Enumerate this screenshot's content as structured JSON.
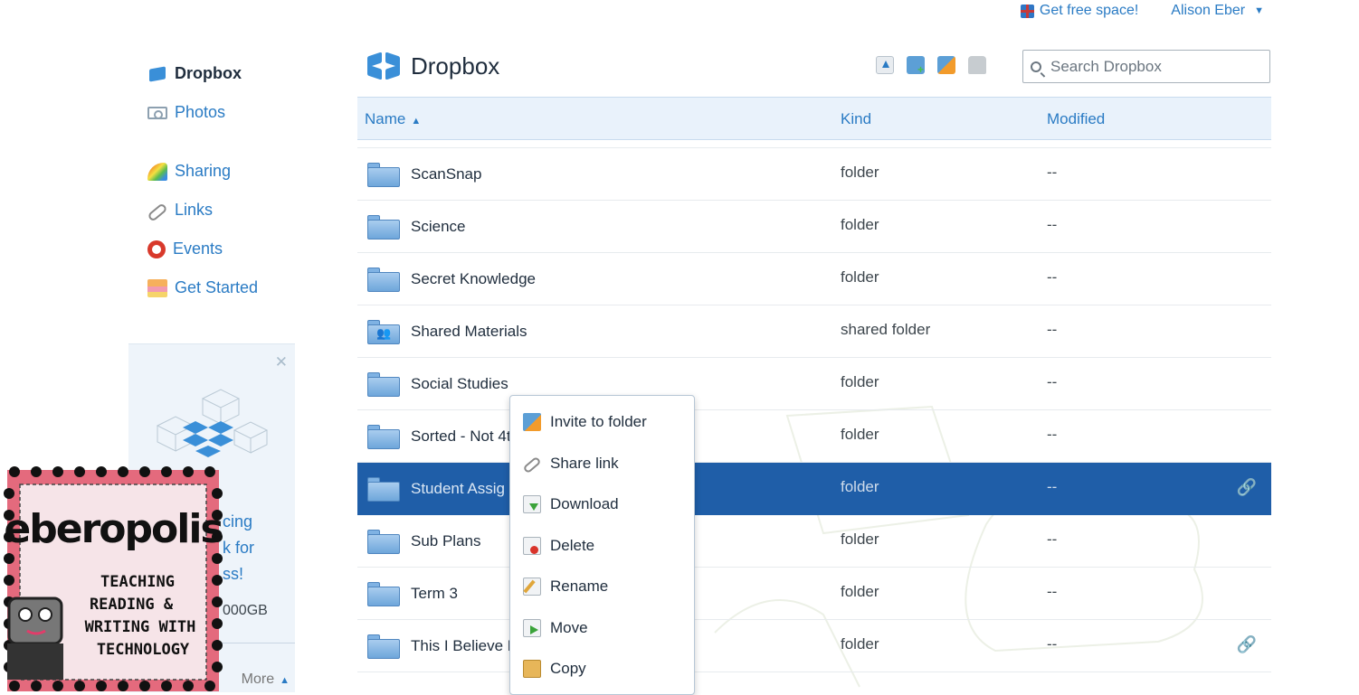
{
  "topbar": {
    "free_space": "Get free space!",
    "user_name": "Alison Eber"
  },
  "sidebar": {
    "items": [
      {
        "label": "Dropbox",
        "icon": "dropbox-icon"
      },
      {
        "label": "Photos",
        "icon": "photos-icon"
      },
      {
        "label": "Sharing",
        "icon": "sharing-icon"
      },
      {
        "label": "Links",
        "icon": "links-icon"
      },
      {
        "label": "Events",
        "icon": "events-icon"
      },
      {
        "label": "Get Started",
        "icon": "cake-icon"
      }
    ]
  },
  "promo": {
    "text_line1": "cing",
    "text_line2": "k for",
    "text_line3": "ss!",
    "size": "000GB",
    "more": "More"
  },
  "badge": {
    "title": "eberopolis",
    "line1": "TEACHING",
    "line2": "READING &",
    "line3": "WRITING WITH",
    "line4": "TECHNOLOGY"
  },
  "main": {
    "title": "Dropbox",
    "search_placeholder": "Search Dropbox"
  },
  "table": {
    "columns": {
      "name": "Name",
      "kind": "Kind",
      "modified": "Modified"
    },
    "rows": [
      {
        "name": "ScanSnap",
        "kind": "folder",
        "modified": "--"
      },
      {
        "name": "Science",
        "kind": "folder",
        "modified": "--"
      },
      {
        "name": "Secret Knowledge",
        "kind": "folder",
        "modified": "--"
      },
      {
        "name": "Shared Materials",
        "kind": "shared folder",
        "modified": "--"
      },
      {
        "name": "Social Studies",
        "kind": "folder",
        "modified": "--"
      },
      {
        "name": "Sorted - Not 4t",
        "kind": "folder",
        "modified": "--"
      },
      {
        "name": "Student Assig",
        "kind": "folder",
        "modified": "--"
      },
      {
        "name": "Sub Plans",
        "kind": "folder",
        "modified": "--"
      },
      {
        "name": "Term 3",
        "kind": "folder",
        "modified": "--"
      },
      {
        "name": "This I Believe N",
        "kind": "folder",
        "modified": "--"
      }
    ]
  },
  "context_menu": {
    "items": [
      {
        "label": "Invite to folder",
        "icon": "invite-folder-icon"
      },
      {
        "label": "Share link",
        "icon": "share-link-icon"
      },
      {
        "label": "Download",
        "icon": "download-icon"
      },
      {
        "label": "Delete",
        "icon": "delete-icon"
      },
      {
        "label": "Rename",
        "icon": "rename-icon"
      },
      {
        "label": "Move",
        "icon": "move-icon"
      },
      {
        "label": "Copy",
        "icon": "copy-icon"
      }
    ]
  },
  "colors": {
    "link": "#2a7bc4",
    "selected_row": "#1f5ea8",
    "header_bg": "#e9f2fb"
  }
}
